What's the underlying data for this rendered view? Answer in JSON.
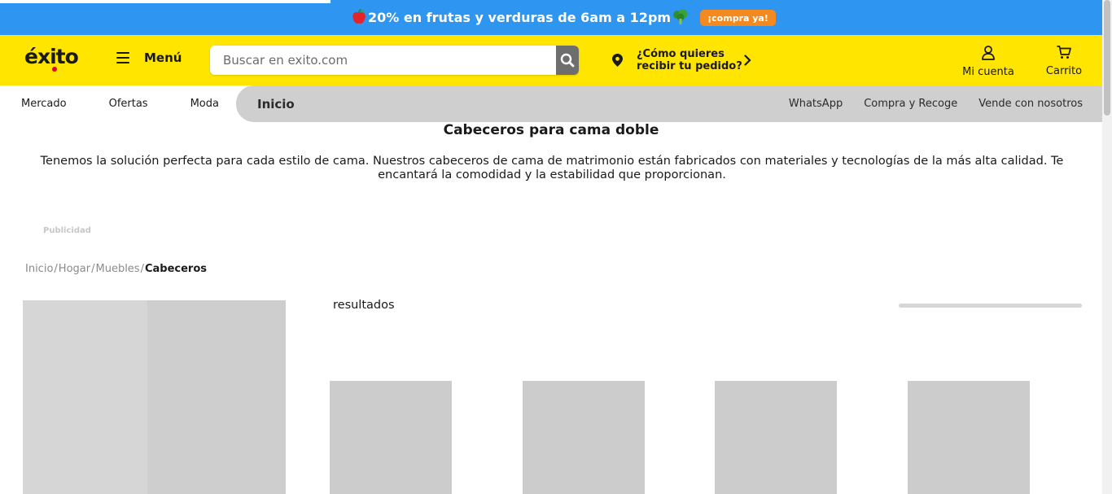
{
  "promo": {
    "text": "20% en frutas y verduras de 6am a 12pm",
    "cta": "¡compra ya!",
    "icons": [
      "apple-icon",
      "broccoli-icon"
    ]
  },
  "header": {
    "logo": "éxito",
    "menu_label": "Menú",
    "search_placeholder": "Buscar en exito.com",
    "delivery_line1": "¿Cómo quieres",
    "delivery_line2": "recibir tu pedido?",
    "account_label": "Mi cuenta",
    "cart_label": "Carrito"
  },
  "nav": {
    "left_items": [
      "Mercado",
      "Ofertas",
      "Moda"
    ],
    "active": "Inicio",
    "right_items": [
      "WhatsApp",
      "Compra y Recoge",
      "Vende con nosotros"
    ]
  },
  "content": {
    "title": "Cabeceros para cama doble",
    "description": "Tenemos la solución perfecta para cada estilo de cama. Nuestros cabeceros de cama de matrimonio están fabricados con materiales y tecnologías de la más alta calidad. Te encantará la comodidad y la estabilidad que proporcionan.",
    "ad_label": "Publicidad",
    "results_label": "resultados"
  },
  "breadcrumb": {
    "items": [
      "Inicio",
      "Hogar",
      "Muebles",
      "Cabeceros"
    ]
  },
  "colors": {
    "promo_blue": "#2e96f0",
    "header_yellow": "#ffe500",
    "cta_orange": "#f4891f",
    "placeholder_gray": "#cccccc"
  }
}
